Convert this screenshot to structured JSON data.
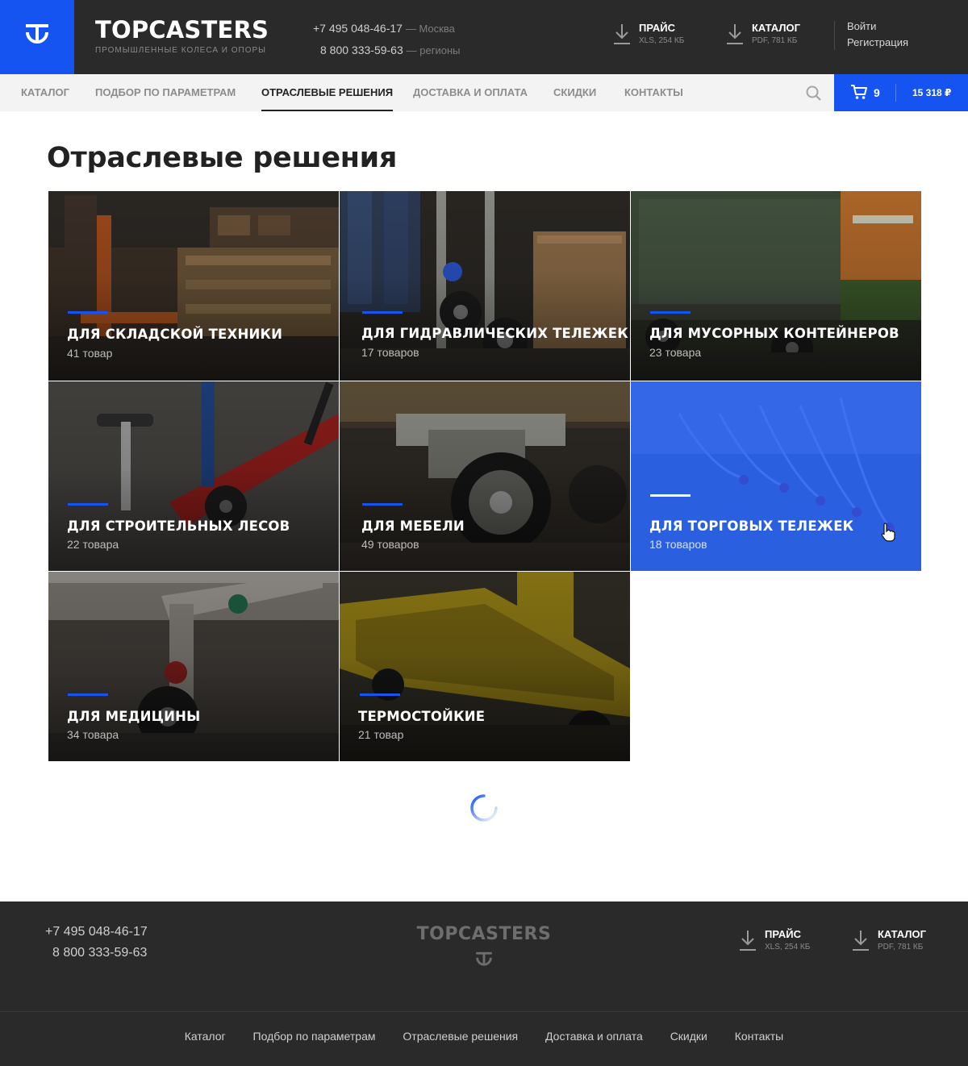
{
  "header": {
    "brand_name": "TOPCASTERS",
    "brand_tagline": "ПРОМЫШЛЕННЫЕ КОЛЕСА И ОПОРЫ",
    "phone_moscow": "+7 495 048-46-17",
    "city_moscow": "— Москва",
    "phone_regions": "8 800 333-59-63",
    "city_regions": "— регионы",
    "price_download": {
      "title": "ПРАЙС",
      "meta": "XLS, 254 КБ"
    },
    "catalog_download": {
      "title": "КАТАЛОГ",
      "meta": "PDF, 781 КБ"
    },
    "login": "Войти",
    "register": "Регистрация"
  },
  "nav": {
    "items": [
      {
        "label": "КАТАЛОГ"
      },
      {
        "label": "ПОДБОР ПО ПАРАМЕТРАМ"
      },
      {
        "label": "ОТРАСЛЕВЫЕ РЕШЕНИЯ",
        "active": true
      },
      {
        "label": "ДОСТАВКА И ОПЛАТА"
      },
      {
        "label": "СКИДКИ"
      },
      {
        "label": "КОНТАКТЫ"
      }
    ],
    "cart": {
      "count": "9",
      "total": "15 318 ₽"
    }
  },
  "main": {
    "title": "Отраслевые решения",
    "tiles": [
      {
        "title": "ДЛЯ СКЛАДСКОЙ ТЕХНИКИ",
        "count": "41 товар"
      },
      {
        "title": "ДЛЯ ГИДРАВЛИЧЕСКИХ ТЕЛЕЖЕК",
        "count": "17 товаров"
      },
      {
        "title": "ДЛЯ МУСОРНЫХ КОНТЕЙНЕРОВ",
        "count": "23 товара"
      },
      {
        "title": "ДЛЯ СТРОИТЕЛЬНЫХ ЛЕСОВ",
        "count": "22 товара"
      },
      {
        "title": "ДЛЯ МЕБЕЛИ",
        "count": "49 товаров"
      },
      {
        "title": "ДЛЯ ТОРГОВЫХ ТЕЛЕЖЕК",
        "count": "18 товаров",
        "hovered": true
      },
      {
        "title": "ДЛЯ МЕДИЦИНЫ",
        "count": "34 товара"
      },
      {
        "title": "ТЕРМОСТОЙКИЕ",
        "count": "21 товар"
      }
    ]
  },
  "footer": {
    "phone_moscow": "+7 495 048-46-17",
    "phone_regions": "8 800 333-59-63",
    "brand_name": "TOPCASTERS",
    "price_download": {
      "title": "ПРАЙС",
      "meta": "XLS, 254 КБ"
    },
    "catalog_download": {
      "title": "КАТАЛОГ",
      "meta": "PDF, 781 КБ"
    },
    "links": [
      "Каталог",
      "Подбор по параметрам",
      "Отраслевые решения",
      "Доставка и оплата",
      "Скидки",
      "Контакты"
    ]
  },
  "colors": {
    "accent": "#1554f0",
    "header_bg": "#2a2a2a",
    "nav_bg": "#f3f3f3"
  },
  "icons": [
    "logo-icon",
    "download-icon",
    "search-icon",
    "cart-icon",
    "loading-spinner-icon",
    "pointer-cursor-icon"
  ]
}
